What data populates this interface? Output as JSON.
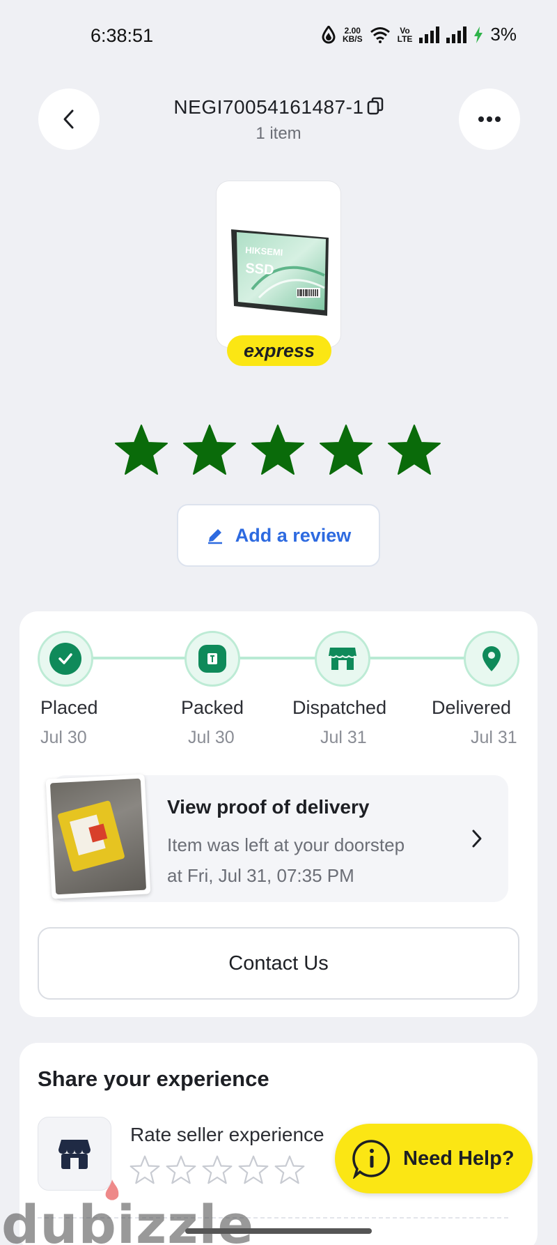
{
  "status_bar": {
    "time": "6:38:51",
    "net_speed": "2.00",
    "net_unit": "KB/S",
    "volte_top": "Vo",
    "volte_bottom": "LTE",
    "battery": "3%"
  },
  "header": {
    "order_id": "NEGI70054161487-1",
    "item_count": "1 item"
  },
  "product": {
    "brand": "HIKSEMI",
    "model": "SSD",
    "badge": "express"
  },
  "rating": {
    "value": 5,
    "max": 5,
    "color": "#0a6b0a"
  },
  "review_button": {
    "label": "Add a review"
  },
  "tracking": {
    "steps": [
      {
        "label": "Placed",
        "date": "Jul 30"
      },
      {
        "label": "Packed",
        "date": "Jul 30"
      },
      {
        "label": "Dispatched",
        "date": "Jul 31"
      },
      {
        "label": "Delivered",
        "date": "Jul 31"
      }
    ]
  },
  "proof": {
    "title": "View proof of delivery",
    "line1": "Item was left at your doorstep",
    "line2": "at Fri, Jul 31, 07:35 PM"
  },
  "contact_button": {
    "label": "Contact Us"
  },
  "share": {
    "title": "Share your experience",
    "rate_seller_label": "Rate seller experience",
    "seller_rating": 0,
    "seller_rating_max": 5
  },
  "help_button": {
    "label": "Need Help?"
  },
  "watermark": {
    "text": "dubizzle"
  },
  "colors": {
    "accent_green": "#0f8a5a",
    "star_green": "#0a6b0a",
    "link_blue": "#2d6ae0",
    "brand_yellow": "#fbe614"
  }
}
